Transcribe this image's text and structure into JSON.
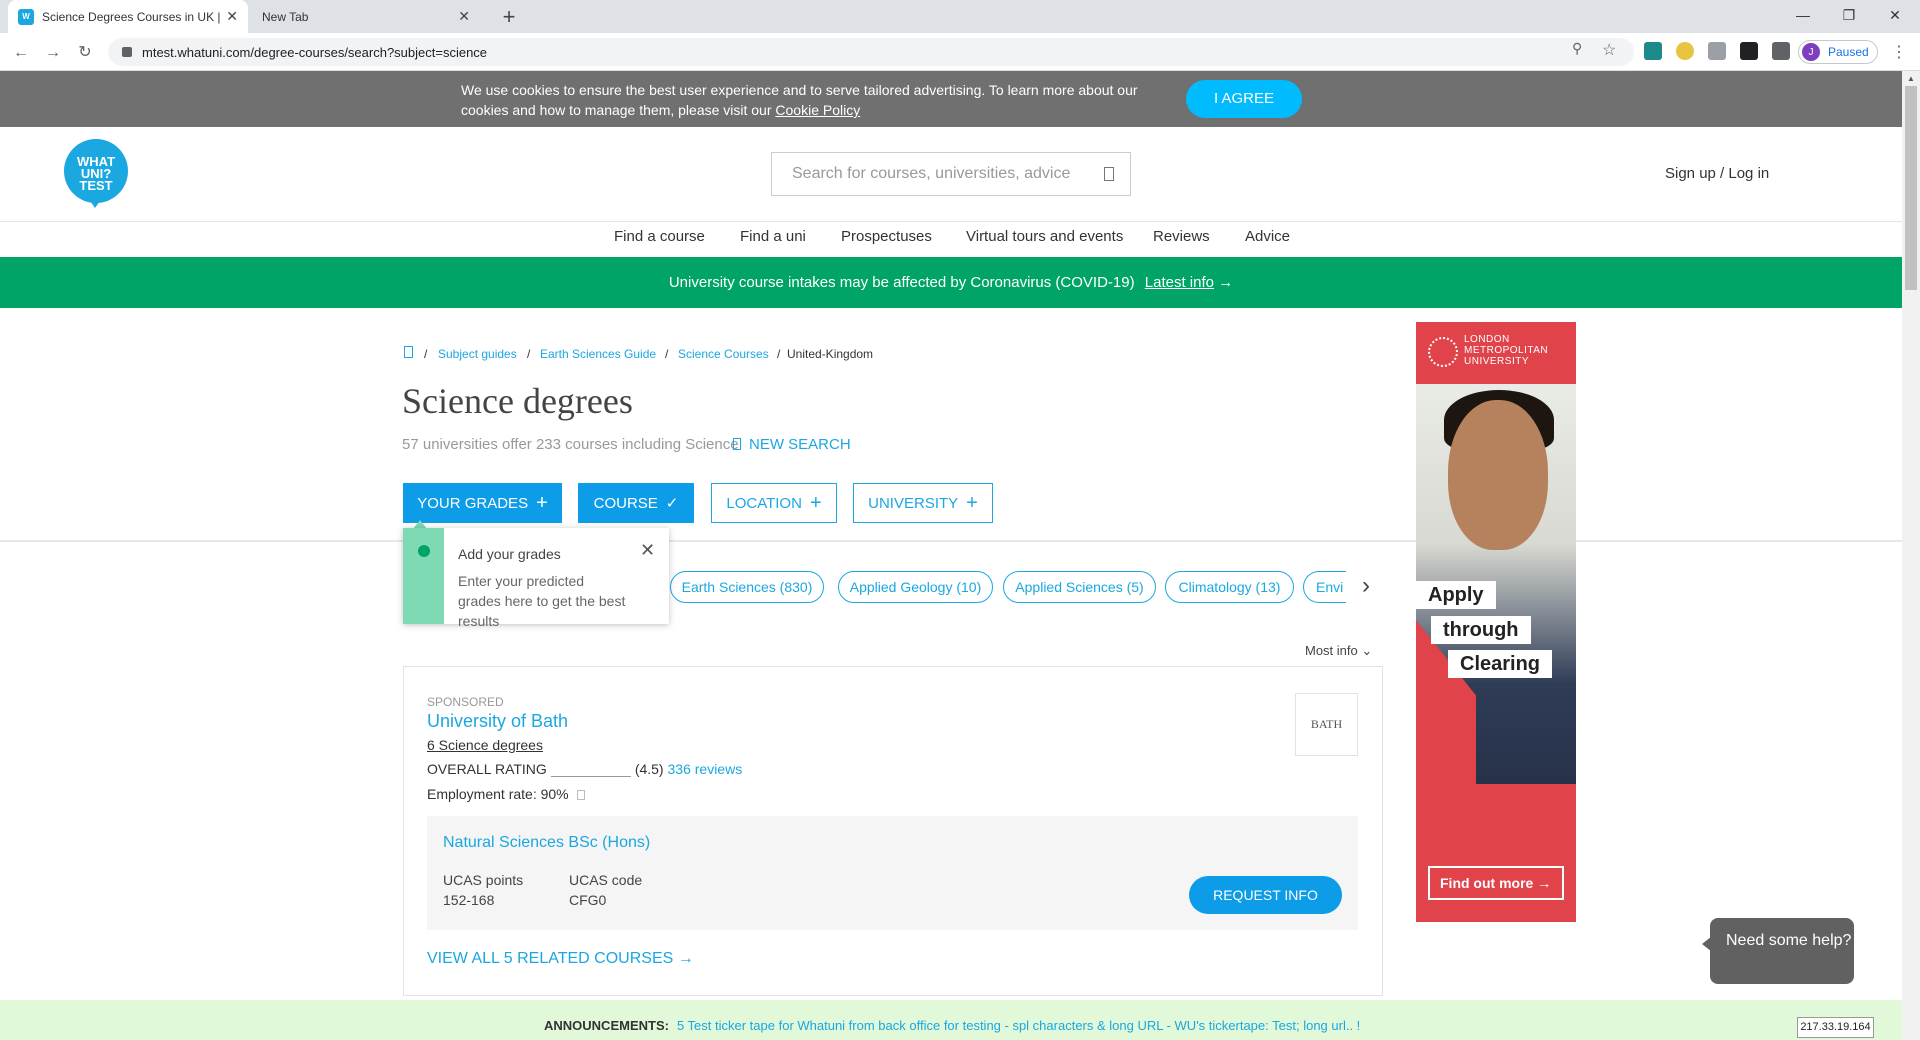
{
  "browser": {
    "tabs": [
      {
        "title": "Science Degrees Courses in UK |",
        "active": true
      },
      {
        "title": "New Tab",
        "active": false
      }
    ],
    "url": "mtest.whatuni.com/degree-courses/search?subject=science",
    "profile_label": "Paused",
    "profile_initial": "J"
  },
  "cookie": {
    "text": "We use cookies to ensure the best user experience and to serve tailored advertising. To learn more about our cookies and how to manage them, please visit our",
    "link": "Cookie Policy",
    "agree": "I AGREE"
  },
  "header": {
    "logo_text": "WHAT UNI? TEST",
    "search_placeholder": "Search for courses, universities, advice",
    "signup": "Sign up / Log in",
    "nav": [
      "Find a course",
      "Find a uni",
      "Prospectuses",
      "Virtual tours and events",
      "Reviews",
      "Advice"
    ]
  },
  "covid": {
    "text": "University course intakes may be affected by Coronavirus (COVID-19)",
    "link": "Latest info"
  },
  "breadcrumb": [
    "Subject guides",
    "Earth Sciences Guide",
    "Science Courses",
    "United-Kingdom"
  ],
  "page": {
    "title": "Science degrees",
    "subtitle": "57 universities offer 233 courses including Science",
    "new_search": "NEW SEARCH"
  },
  "filters": {
    "your_grades": "YOUR GRADES",
    "course": "COURSE",
    "location": "LOCATION",
    "university": "UNIVERSITY"
  },
  "tooltip": {
    "title": "Add your grades",
    "body": "Enter your predicted grades here to get the best results"
  },
  "subject_pills": [
    "Earth Sciences (830)",
    "Applied Geology (10)",
    "Applied Sciences (5)",
    "Climatology (13)",
    "Envi"
  ],
  "sort_label": "Most info",
  "result": {
    "sponsored": "SPONSORED",
    "university": "University of Bath",
    "degree_count": "6 Science degrees",
    "rating_label": "OVERALL RATING",
    "rating_value": "(4.5)",
    "reviews": "336 reviews",
    "employment": "Employment rate: 90%",
    "logo_text": "BATH",
    "course_name": "Natural Sciences BSc (Hons)",
    "ucas_points_label": "UCAS points",
    "ucas_points": "152-168",
    "ucas_code_label": "UCAS code",
    "ucas_code": "CFG0",
    "request_info": "REQUEST INFO",
    "view_all": "VIEW ALL 5 RELATED COURSES"
  },
  "ad": {
    "brand": "LONDON METROPOLITAN UNIVERSITY",
    "words": [
      "Apply",
      "through",
      "Clearing"
    ],
    "button": "Find out more"
  },
  "help": {
    "text": "Need some help?"
  },
  "ticker": {
    "label": "ANNOUNCEMENTS:",
    "text": "5 Test ticker tape for Whatuni from back office for testing - spl characters & long URL - WU's tickertape: Test; long url.. !"
  },
  "ip": "217.33.19.164",
  "colors": {
    "brand_blue": "#1ba7e0",
    "covid_green": "#00a466",
    "ad_red": "#e1434a"
  }
}
